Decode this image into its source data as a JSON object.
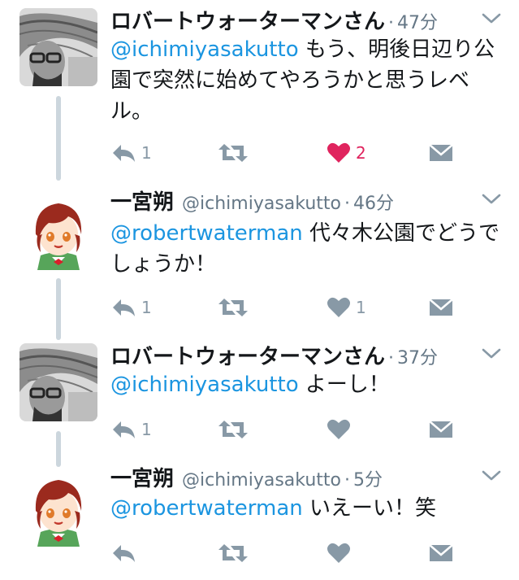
{
  "tweets": [
    {
      "name": "ロバートウォーターマンさん",
      "handle": "",
      "dot": "·",
      "time": "47分",
      "mention": "@ichimiyasakutto",
      "body": " もう、明後日辺り公園で突然に始めてやろうかと思うレベル。",
      "reply_count": "1",
      "retweet_count": "",
      "like_count": "2",
      "liked": true,
      "avatar": "robert-avatar"
    },
    {
      "name": "一宮朔",
      "handle": "@ichimiyasakutto",
      "dot": "·",
      "time": "46分",
      "mention": "@robertwaterman",
      "body": " 代々木公園でどうでしょうか！",
      "reply_count": "1",
      "retweet_count": "",
      "like_count": "1",
      "liked": false,
      "avatar": "sakutto-avatar"
    },
    {
      "name": "ロバートウォーターマンさん",
      "handle": "",
      "dot": "·",
      "time": "37分",
      "mention": "@ichimiyasakutto",
      "body": " よーし！",
      "reply_count": "1",
      "retweet_count": "",
      "like_count": "",
      "liked": false,
      "avatar": "robert-avatar"
    },
    {
      "name": "一宮朔",
      "handle": "@ichimiyasakutto",
      "dot": "·",
      "time": "5分",
      "mention": "@robertwaterman",
      "body": " いえーい！笑",
      "reply_count": "",
      "retweet_count": "",
      "like_count": "",
      "liked": false,
      "avatar": "sakutto-avatar"
    }
  ],
  "colors": {
    "mention": "#1b95e0",
    "icon": "#8899a6",
    "liked": "#e0245e",
    "connector": "#ccd6dd",
    "meta": "#657786"
  },
  "icons": {
    "reply": "reply-icon",
    "retweet": "retweet-icon",
    "like": "heart-icon",
    "dm": "direct-message-icon",
    "more": "chevron-down-icon"
  }
}
